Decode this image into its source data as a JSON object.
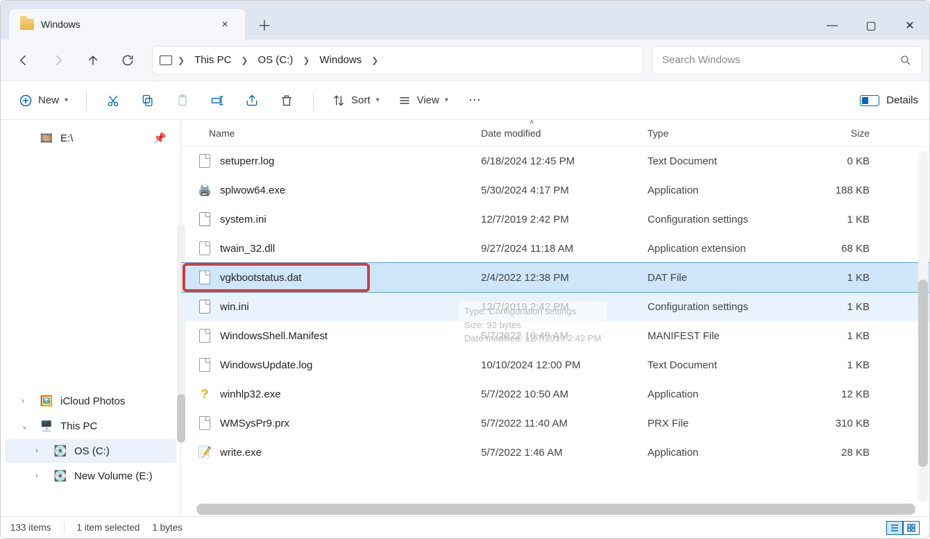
{
  "window": {
    "title": "Windows"
  },
  "breadcrumbs": {
    "seg1": "This PC",
    "seg2": "OS (C:)",
    "seg3": "Windows"
  },
  "search": {
    "placeholder": "Search Windows"
  },
  "toolbar": {
    "new": "New",
    "sort": "Sort",
    "view": "View",
    "details": "Details"
  },
  "columns": {
    "name": "Name",
    "date": "Date modified",
    "type": "Type",
    "size": "Size"
  },
  "sidebar": {
    "e_drive": "E:\\",
    "icloud": "iCloud Photos",
    "thispc": "This PC",
    "osc": "OS (C:)",
    "newvol": "New Volume (E:)"
  },
  "files": [
    {
      "name": "setuperr.log",
      "date": "6/18/2024 12:45 PM",
      "type": "Text Document",
      "size": "0 KB",
      "icon": "text"
    },
    {
      "name": "splwow64.exe",
      "date": "5/30/2024 4:17 PM",
      "type": "Application",
      "size": "188 KB",
      "icon": "printer"
    },
    {
      "name": "system.ini",
      "date": "12/7/2019 2:42 PM",
      "type": "Configuration settings",
      "size": "1 KB",
      "icon": "gear"
    },
    {
      "name": "twain_32.dll",
      "date": "9/27/2024 11:18 AM",
      "type": "Application extension",
      "size": "68 KB",
      "icon": "dll"
    },
    {
      "name": "vgkbootstatus.dat",
      "date": "2/4/2022 12:38 PM",
      "type": "DAT File",
      "size": "1 KB",
      "icon": "file",
      "selected": true,
      "highlighted": true
    },
    {
      "name": "win.ini",
      "date": "12/7/2019 2:42 PM",
      "type": "Configuration settings",
      "size": "1 KB",
      "icon": "gear",
      "hover": true
    },
    {
      "name": "WindowsShell.Manifest",
      "date": "5/7/2022 10:49 AM",
      "type": "MANIFEST File",
      "size": "1 KB",
      "icon": "file"
    },
    {
      "name": "WindowsUpdate.log",
      "date": "10/10/2024 12:00 PM",
      "type": "Text Document",
      "size": "1 KB",
      "icon": "text"
    },
    {
      "name": "winhlp32.exe",
      "date": "5/7/2022 10:50 AM",
      "type": "Application",
      "size": "12 KB",
      "icon": "help"
    },
    {
      "name": "WMSysPr9.prx",
      "date": "5/7/2022 11:40 AM",
      "type": "PRX File",
      "size": "310 KB",
      "icon": "file"
    },
    {
      "name": "write.exe",
      "date": "5/7/2022 1:46 AM",
      "type": "Application",
      "size": "28 KB",
      "icon": "write"
    }
  ],
  "tooltip": {
    "l1": "Type: Configuration settings",
    "l2": "Size: 92 bytes",
    "l3": "Date modified: 12/7/2019 2:42 PM"
  },
  "status": {
    "items": "133 items",
    "selected": "1 item selected",
    "bytes": "1 bytes"
  }
}
